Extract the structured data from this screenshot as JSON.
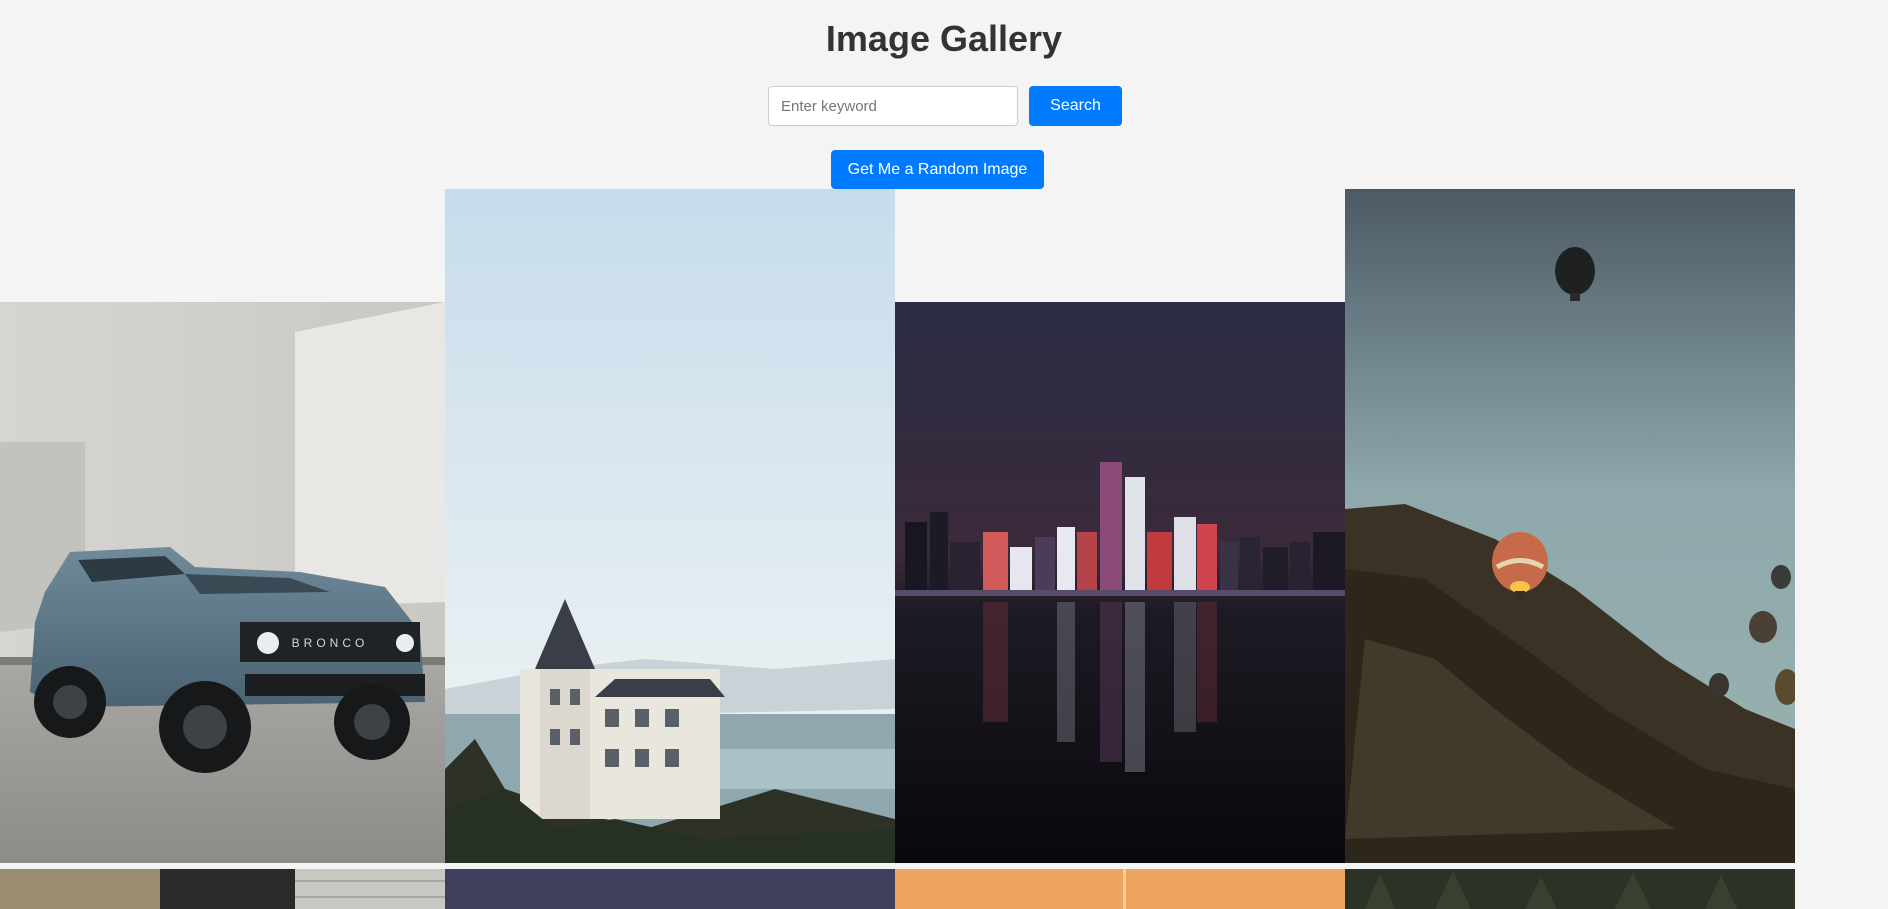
{
  "page": {
    "title": "Image Gallery"
  },
  "search": {
    "placeholder": "Enter keyword",
    "value": "",
    "button_label": "Search"
  },
  "random": {
    "button_label": "Get Me a Random Image"
  },
  "colors": {
    "background": "#f4f4f4",
    "accent": "#007bff",
    "title_text": "#333333"
  },
  "gallery": {
    "images": [
      {
        "subject": "blue Ford Bronco SUV parked by white wall",
        "badge_text": "BRONCO"
      },
      {
        "subject": "seaside château on cliff under pale sky"
      },
      {
        "subject": "city skyline at night reflected in water"
      },
      {
        "subject": "hot air balloons over rocky hillside"
      },
      {
        "subject": "brick wall photo (partially visible)"
      },
      {
        "subject": "dusk sky photo (partially visible)"
      },
      {
        "subject": "orange sunset photo (partially visible)"
      },
      {
        "subject": "pine forest photo (partially visible)"
      }
    ]
  }
}
